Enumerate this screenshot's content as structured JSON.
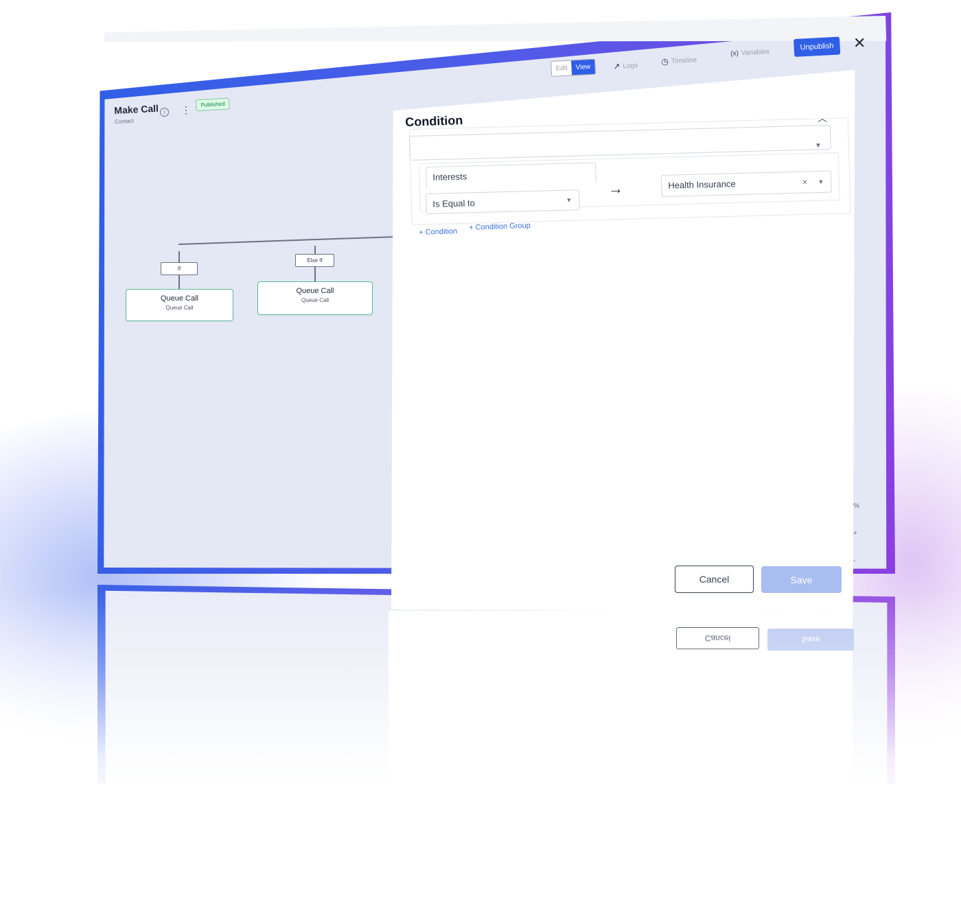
{
  "header": {
    "title": "Make Call",
    "subtitle": "Contact",
    "status_badge": "Published",
    "mode_toggle": {
      "edit": "Edit",
      "view": "View",
      "selected": "View"
    },
    "tools": {
      "logs": "Logs",
      "timeline": "Timeline",
      "variables": "Variables"
    },
    "unpublish_label": "Unpublish",
    "close_glyph": "✕"
  },
  "flow": {
    "branches": [
      {
        "label": "If",
        "node_title": "Queue Call",
        "node_subtitle": "Queue Call"
      },
      {
        "label": "Else If",
        "node_title": "Queue Call",
        "node_subtitle": "Queue Call"
      }
    ]
  },
  "condition_panel": {
    "title": "Condition",
    "rule": {
      "field": "Interests",
      "operator": "Is Equal to",
      "value": "Health Insurance"
    },
    "add_condition": "+ Condition",
    "add_condition_group": "+ Condition Group",
    "cancel_label": "Cancel",
    "save_label": "Save"
  },
  "zoom": {
    "percent_suffix": "%",
    "plus": "+",
    "minus": "-"
  },
  "colors": {
    "accent": "#2f5fe6",
    "frame_gradient_end": "#8b3fe0",
    "node_border": "#5cb89a",
    "badge_text": "#15803d",
    "save_disabled": "#a9bdf0",
    "link": "#3b6fd8"
  }
}
